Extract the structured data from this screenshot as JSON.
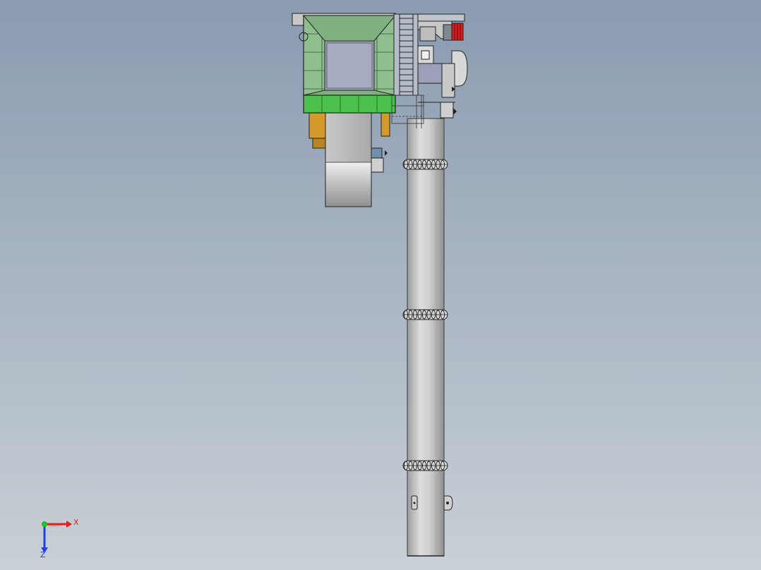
{
  "viewport": {
    "background_top": "#8a9bb0",
    "background_bottom": "#c9d0d6",
    "colors": {
      "hopper_green": "#8fbf8f",
      "hopper_band": "#4cc04c",
      "conveyor_gray": "#b9b9b9",
      "drum_light": "#eeeeee",
      "drum_dark": "#8f8f8f",
      "amber": "#d39a2a",
      "motor_red": "#cc2222",
      "outline": "#222222",
      "triad_x": "#e02020",
      "triad_y": "#20c020",
      "triad_z": "#2040e0"
    }
  },
  "triad": {
    "x_label": "X",
    "z_label": "Z"
  }
}
